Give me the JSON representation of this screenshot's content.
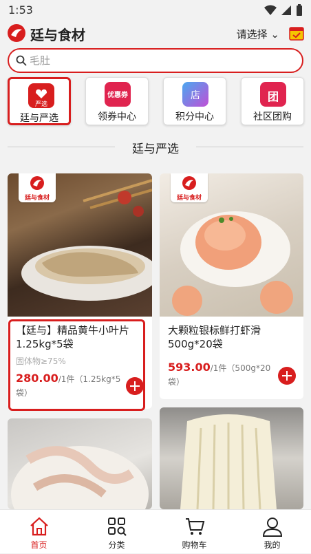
{
  "status": {
    "time": "1:53"
  },
  "header": {
    "title": "廷与食材",
    "city_select": "请选择"
  },
  "search": {
    "placeholder": "毛肚"
  },
  "quick_links": [
    {
      "label": "廷与严选",
      "icon": "strict-select-icon",
      "icon_text": "严选",
      "color": "#d81e1e"
    },
    {
      "label": "领券中心",
      "icon": "coupon-icon",
      "icon_text": "优惠券",
      "color": "#e0244f"
    },
    {
      "label": "积分中心",
      "icon": "points-shop-icon",
      "icon_text": "店",
      "color": "#7b4fd6"
    },
    {
      "label": "社区团购",
      "icon": "group-buy-icon",
      "icon_text": "团",
      "color": "#e0244f"
    }
  ],
  "section_title": "廷与严选",
  "products": [
    {
      "name": "【廷与】精品黄牛小叶片1.25kg*5袋",
      "spec": "固体物≥75%",
      "price": "280.00",
      "unit": "/1件（1.25kg*5袋）",
      "brand_badge": "廷与食材"
    },
    {
      "name": "大颗粒银标鲜打虾滑500g*20袋",
      "spec": "",
      "price": "593.00",
      "unit": "/1件（500g*20袋）",
      "brand_badge": "廷与食材"
    },
    {
      "name": "",
      "spec": "",
      "price": "",
      "unit": ""
    },
    {
      "name": "",
      "spec": "",
      "price": "",
      "unit": ""
    }
  ],
  "tabbar": [
    {
      "label": "首页",
      "icon": "home-icon",
      "active": true
    },
    {
      "label": "分类",
      "icon": "category-icon",
      "active": false
    },
    {
      "label": "购物车",
      "icon": "cart-icon",
      "active": false
    },
    {
      "label": "我的",
      "icon": "profile-icon",
      "active": false
    }
  ],
  "colors": {
    "accent": "#d81e1e",
    "background": "#f2f2f2"
  }
}
